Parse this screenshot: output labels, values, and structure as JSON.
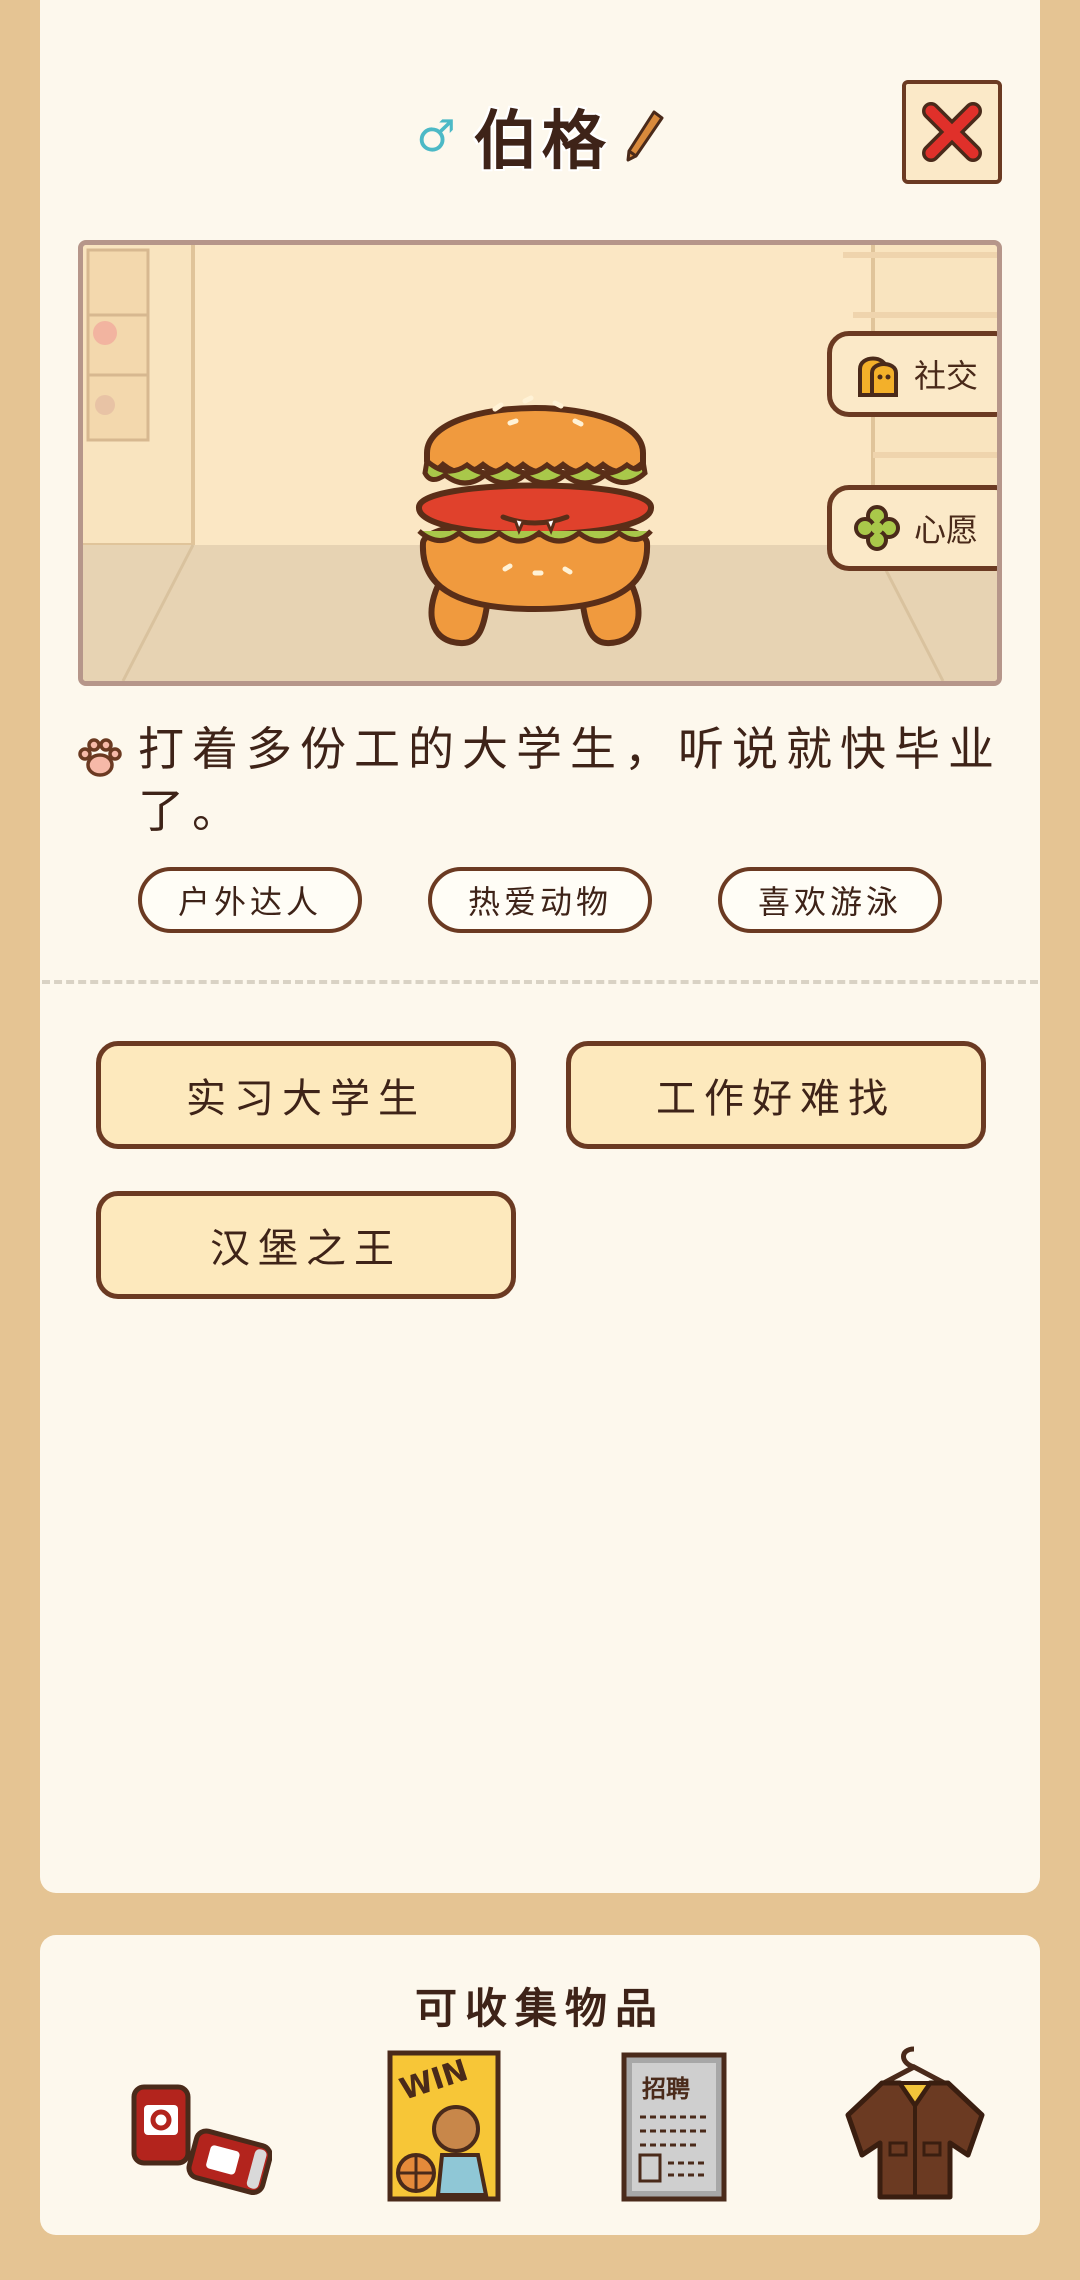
{
  "profile": {
    "gender_symbol": "♂",
    "name": "伯格",
    "description": "打着多份工的大学生，听说就快毕业了。",
    "tags": [
      "户外达人",
      "热爱动物",
      "喜欢游泳"
    ]
  },
  "scene": {
    "social_label": "社交",
    "wish_label": "心愿"
  },
  "traits": [
    "实习大学生",
    "工作好难找",
    "汉堡之王"
  ],
  "collectibles": {
    "title": "可收集物品",
    "items": [
      "soda-cans",
      "win-poster",
      "recruit-flyer",
      "jacket"
    ]
  },
  "colors": {
    "background": "#e5c493",
    "card": "#fdf8ed",
    "outline": "#6b3a22",
    "button_fill": "#fde9bd",
    "close_x": "#e0302a"
  }
}
